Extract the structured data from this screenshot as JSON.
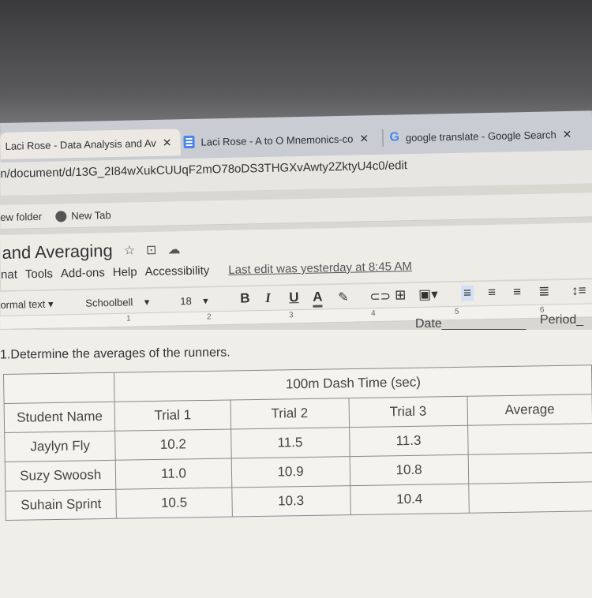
{
  "browser": {
    "tabs": [
      {
        "label": "Laci Rose - Data Analysis and Av",
        "active": true,
        "icon": "docs-icon"
      },
      {
        "label": "Laci Rose - A to O Mnemonics-co",
        "active": false,
        "icon": "docs-icon"
      },
      {
        "label": "google translate - Google Search",
        "active": false,
        "icon": "google-icon"
      }
    ],
    "close_glyph": "✕",
    "address": "n/document/d/13G_2I84wXukCUUqF2mO78oDS3THGXvAwty2ZktyU4c0/edit",
    "bookmarks": [
      {
        "label": "ew folder"
      },
      {
        "label": "New Tab"
      }
    ]
  },
  "docs": {
    "title": "and Averaging",
    "menus": [
      "nat",
      "Tools",
      "Add-ons",
      "Help",
      "Accessibility"
    ],
    "last_edit": "Last edit was yesterday at 8:45 AM",
    "toolbar": {
      "style": "ormal text",
      "font": "Schoolbell",
      "size": "18",
      "bold": "B",
      "italic": "I",
      "underline": "U",
      "text_color": "A"
    },
    "ruler_marks": [
      "1",
      "2",
      "3",
      "4",
      "5",
      "6"
    ]
  },
  "document": {
    "date_label": "Date",
    "period_label": "Period",
    "question": "1.Determine the averages of the runners.",
    "table": {
      "group_header": "100m Dash Time (sec)",
      "columns": [
        "Student Name",
        "Trial 1",
        "Trial 2",
        "Trial 3",
        "Average"
      ],
      "rows": [
        {
          "name": "Jaylyn Fly",
          "trial1": "10.2",
          "trial2": "11.5",
          "trial3": "11.3",
          "average": ""
        },
        {
          "name": "Suzy Swoosh",
          "trial1": "11.0",
          "trial2": "10.9",
          "trial3": "10.8",
          "average": ""
        },
        {
          "name": "Suhain Sprint",
          "trial1": "10.5",
          "trial2": "10.3",
          "trial3": "10.4",
          "average": ""
        }
      ]
    }
  }
}
